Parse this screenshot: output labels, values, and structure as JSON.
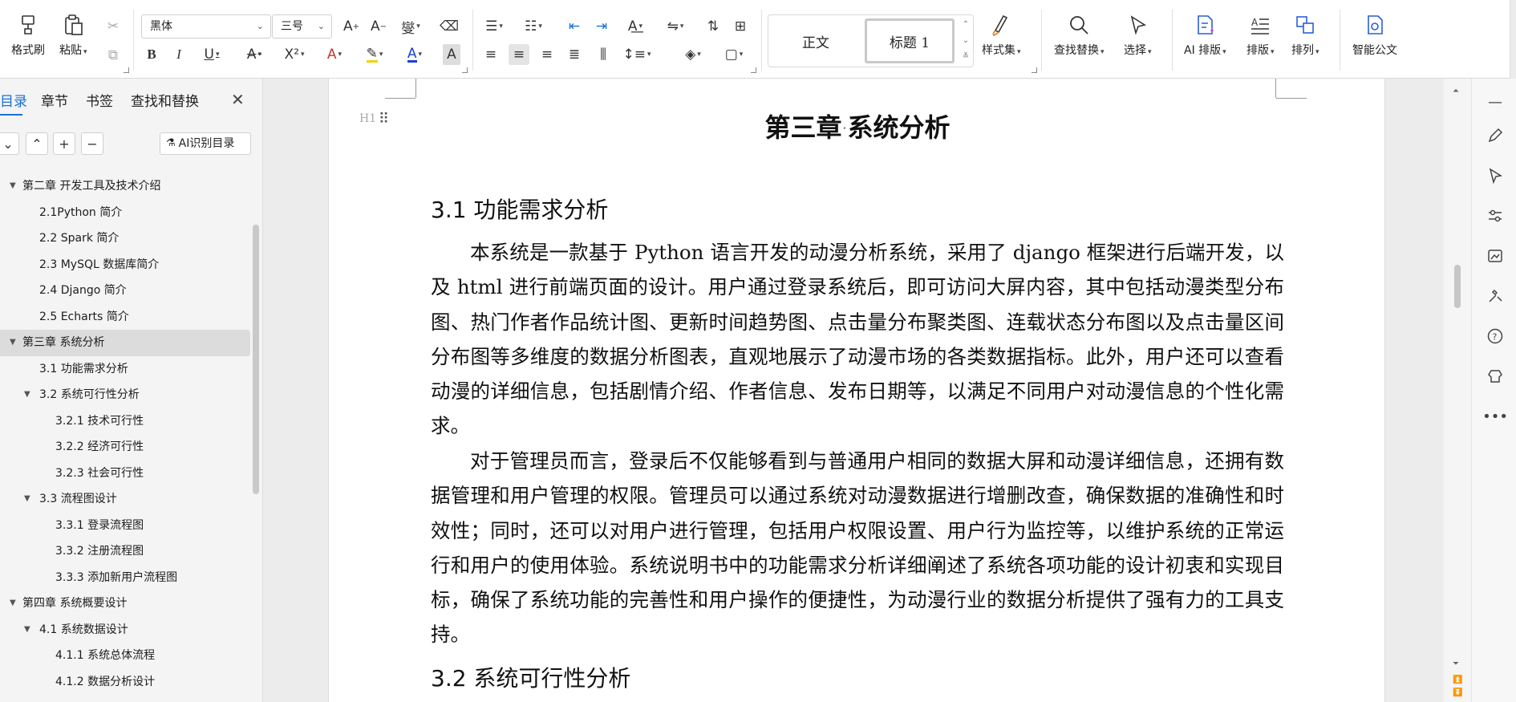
{
  "ribbon": {
    "format_painter": "格式刷",
    "paste": "粘贴",
    "font_name": "黑体",
    "font_size": "三号",
    "styles": {
      "normal": "正文",
      "heading1": "标题 1"
    },
    "style_set": "样式集",
    "find_replace": "查找替换",
    "select": "选择",
    "ai_layout": "AI 排版",
    "layout": "排版",
    "arrange": "排列",
    "smart_doc": "智能公文"
  },
  "nav": {
    "tabs": [
      "目录",
      "章节",
      "书签",
      "查找和替换"
    ],
    "ai_toc": "AI识别目录",
    "items": [
      {
        "label": "第二章  开发工具及技术介绍",
        "level": 1,
        "expanded": true
      },
      {
        "label": "2.1Python 简介",
        "level": 2
      },
      {
        "label": "2.2 Spark 简介",
        "level": 2
      },
      {
        "label": "2.3 MySQL 数据库简介",
        "level": 2
      },
      {
        "label": "2.4 Django 简介",
        "level": 2
      },
      {
        "label": "2.5 Echarts 简介",
        "level": 2
      },
      {
        "label": "第三章  系统分析",
        "level": 1,
        "expanded": true,
        "selected": true
      },
      {
        "label": "3.1 功能需求分析",
        "level": 2
      },
      {
        "label": "3.2 系统可行性分析",
        "level": 2,
        "expanded": true
      },
      {
        "label": "3.2.1 技术可行性",
        "level": 3
      },
      {
        "label": "3.2.2  经济可行性",
        "level": 3
      },
      {
        "label": "3.2.3 社会可行性",
        "level": 3
      },
      {
        "label": "3.3 流程图设计",
        "level": 2,
        "expanded": true
      },
      {
        "label": "3.3.1  登录流程图",
        "level": 3
      },
      {
        "label": "3.3.2  注册流程图",
        "level": 3
      },
      {
        "label": "3.3.3  添加新用户流程图",
        "level": 3
      },
      {
        "label": "第四章  系统概要设计",
        "level": 1,
        "expanded": true
      },
      {
        "label": "4.1 系统数据设计",
        "level": 2,
        "expanded": true
      },
      {
        "label": "4.1.1    系统总体流程",
        "level": 3
      },
      {
        "label": "4.1.2    数据分析设计",
        "level": 3
      }
    ]
  },
  "doc": {
    "h1_marker": "H1",
    "chapter_title_a": "第三章",
    "chapter_title_b": "系统分析",
    "sec1": "3.1 功能需求分析",
    "para1": "本系统是一款基于 Python 语言开发的动漫分析系统，采用了 django 框架进行后端开发，以及 html 进行前端页面的设计。用户通过登录系统后，即可访问大屏内容，其中包括动漫类型分布图、热门作者作品统计图、更新时间趋势图、点击量分布聚类图、连载状态分布图以及点击量区间分布图等多维度的数据分析图表，直观地展示了动漫市场的各类数据指标。此外，用户还可以查看动漫的详细信息，包括剧情介绍、作者信息、发布日期等，以满足不同用户对动漫信息的个性化需求。",
    "para2": "对于管理员而言，登录后不仅能够看到与普通用户相同的数据大屏和动漫详细信息，还拥有数据管理和用户管理的权限。管理员可以通过系统对动漫数据进行增删改查，确保数据的准确性和时效性；同时，还可以对用户进行管理，包括用户权限设置、用户行为监控等，以维护系统的正常运行和用户的使用体验。系统说明书中的功能需求分析详细阐述了系统各项功能的设计初衷和实现目标，确保了系统功能的完善性和用户操作的便捷性，为动漫行业的数据分析提供了强有力的工具支持。",
    "sec2": "3.2 系统可行性分析"
  },
  "colors": {
    "accent": "#1a6fd8",
    "selected_row": "#dcdcdc",
    "panel_bg": "#f4f4f4"
  }
}
